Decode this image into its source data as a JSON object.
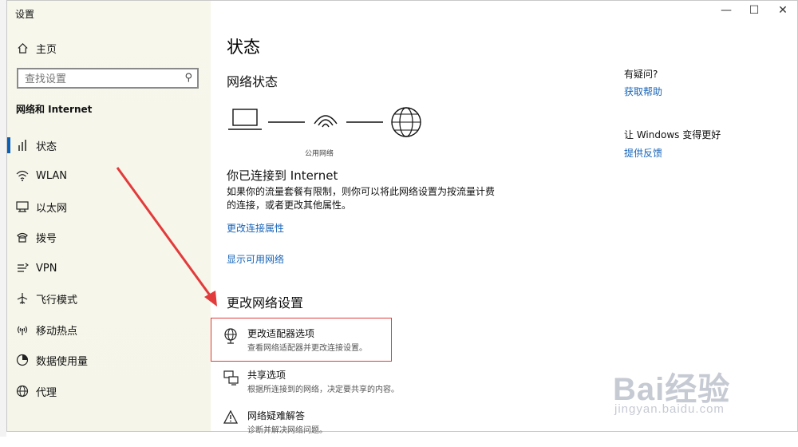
{
  "window": {
    "title": "设置",
    "controls": {
      "minimize": "—",
      "maximize": "☐",
      "close": "✕"
    }
  },
  "sidebar": {
    "home": "主页",
    "search_placeholder": "查找设置",
    "section": "网络和 Internet",
    "items": [
      {
        "label": "状态",
        "icon": "status-icon"
      },
      {
        "label": "WLAN",
        "icon": "wifi-icon"
      },
      {
        "label": "以太网",
        "icon": "ethernet-icon"
      },
      {
        "label": "拨号",
        "icon": "dialup-icon"
      },
      {
        "label": "VPN",
        "icon": "vpn-icon"
      },
      {
        "label": "飞行模式",
        "icon": "airplane-icon"
      },
      {
        "label": "移动热点",
        "icon": "hotspot-icon"
      },
      {
        "label": "数据使用量",
        "icon": "data-usage-icon"
      },
      {
        "label": "代理",
        "icon": "globe-icon"
      }
    ]
  },
  "main": {
    "title": "状态",
    "network_status_heading": "网络状态",
    "network_type_label": "公用网络",
    "connected_heading": "你已连接到 Internet",
    "connected_desc": "如果你的流量套餐有限制，则你可以将此网络设置为按流量计费的连接，或者更改其他属性。",
    "link_change_props": "更改连接属性",
    "link_show_networks": "显示可用网络",
    "change_settings_heading": "更改网络设置",
    "options": [
      {
        "title": "更改适配器选项",
        "desc": "查看网络适配器并更改连接设置。",
        "icon": "globe-icon"
      },
      {
        "title": "共享选项",
        "desc": "根据所连接到的网络，决定要共享的内容。",
        "icon": "sharing-icon"
      },
      {
        "title": "网络疑难解答",
        "desc": "诊断并解决网络问题。",
        "icon": "warning-icon"
      }
    ]
  },
  "right": {
    "question": "有疑问?",
    "get_help": "获取帮助",
    "improve": "让 Windows 变得更好",
    "feedback": "提供反馈"
  },
  "watermark": {
    "brand": "Bai经验",
    "url": "jingyan.baidu.com"
  },
  "colors": {
    "accent": "#0a5fb4",
    "link": "#1764b8",
    "annotation": "#e23b3b"
  }
}
